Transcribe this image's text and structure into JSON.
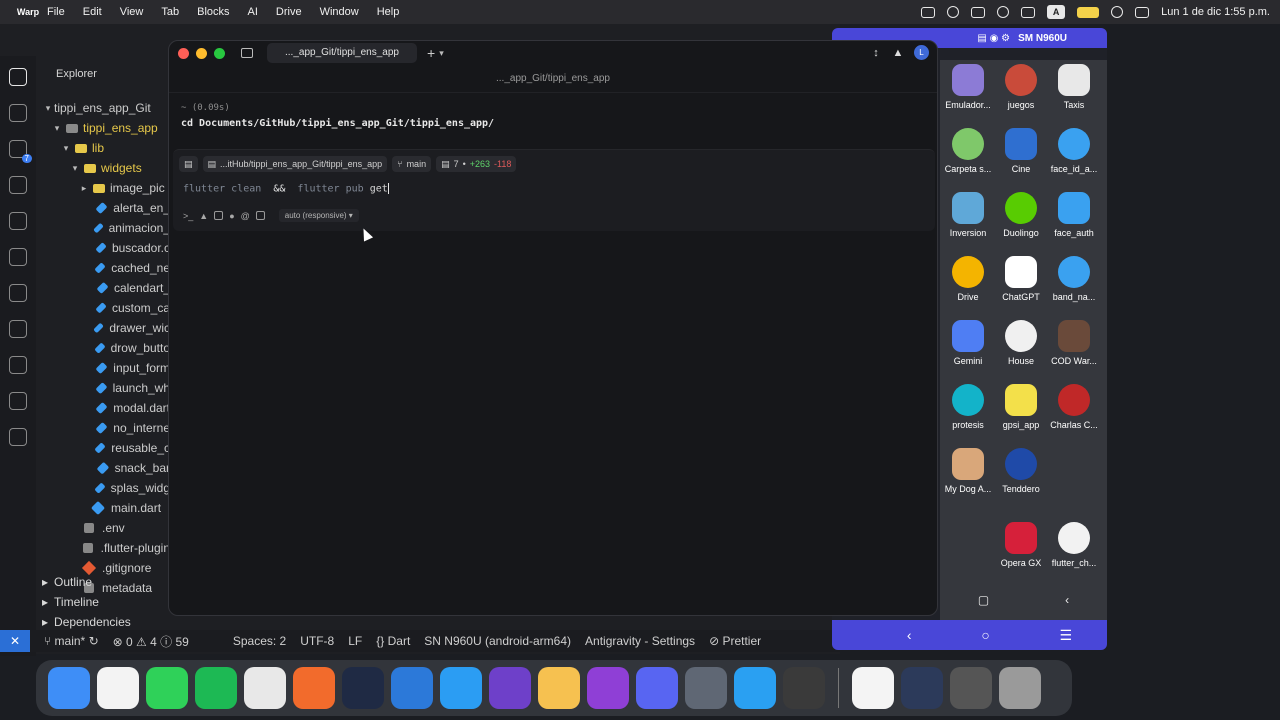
{
  "menubar": {
    "app_name": "Warp",
    "items": [
      "File",
      "Edit",
      "View",
      "Tab",
      "Blocks",
      "AI",
      "Drive",
      "Window",
      "Help"
    ],
    "input_badge": "A",
    "clock": "Lun 1 de dic  1:55 p.m."
  },
  "vscode": {
    "explorer_title": "Explorer",
    "tree": [
      {
        "label": "tippi_ens_app_Git",
        "kind": "root"
      },
      {
        "label": "tippi_ens_app",
        "kind": "folder-open"
      },
      {
        "label": "lib",
        "kind": "folder-open"
      },
      {
        "label": "widgets",
        "kind": "folder-open"
      },
      {
        "label": "image_pic",
        "kind": "folder"
      },
      {
        "label": "alerta_en_",
        "kind": "dart"
      },
      {
        "label": "animacion_",
        "kind": "dart"
      },
      {
        "label": "buscador.c",
        "kind": "dart"
      },
      {
        "label": "cached_ne",
        "kind": "dart"
      },
      {
        "label": "calendart_",
        "kind": "dart"
      },
      {
        "label": "custom_ca",
        "kind": "dart"
      },
      {
        "label": "drawer_wic",
        "kind": "dart"
      },
      {
        "label": "drow_butto",
        "kind": "dart"
      },
      {
        "label": "input_form",
        "kind": "dart"
      },
      {
        "label": "launch_wh",
        "kind": "dart"
      },
      {
        "label": "modal.dart",
        "kind": "dart"
      },
      {
        "label": "no_interne",
        "kind": "dart"
      },
      {
        "label": "reusable_c",
        "kind": "dart"
      },
      {
        "label": "snack_bar",
        "kind": "dart"
      },
      {
        "label": "splas_widg",
        "kind": "dart"
      },
      {
        "label": "main.dart",
        "kind": "dart"
      },
      {
        "label": ".env",
        "kind": "misc"
      },
      {
        "label": ".flutter-plugin",
        "kind": "misc"
      },
      {
        "label": ".gitignore",
        "kind": "git"
      },
      {
        "label": "metadata",
        "kind": "misc"
      }
    ],
    "sections": [
      "Outline",
      "Timeline",
      "Dependencies"
    ],
    "statusbar": {
      "branch": "main*",
      "problems": "0",
      "warnings": "4",
      "infos": "59",
      "spaces": "Spaces: 2",
      "encoding": "UTF-8",
      "eol": "LF",
      "language": "Dart",
      "device": "SN N960U (android-arm64)",
      "settings": "Antigravity - Settings",
      "formatter": "Prettier"
    }
  },
  "warp": {
    "tab_title": "..._app_Git/tippi_ens_app",
    "path_title": "..._app_Git/tippi_ens_app",
    "prev_block": {
      "duration": "~ (0.09s)",
      "command": "cd Documents/GitHub/tippi_ens_app_Git/tippi_ens_app/"
    },
    "input": {
      "cwd_chip": "...itHub/tippi_ens_app_Git/tippi_ens_app",
      "branch_chip": "main",
      "changes_files": "7",
      "changes_added": "+263",
      "changes_removed": "-118",
      "cmd_part1": "flutter clean",
      "cmd_op": "&&",
      "cmd_part2": "flutter pub",
      "cmd_typed": "get",
      "mode": "auto (responsive)",
      "avatar_letter": "L"
    }
  },
  "phone": {
    "device_name": "SM N960U",
    "apps": [
      {
        "label": "Emulador...",
        "color": "#8c7bd6"
      },
      {
        "label": "juegos",
        "color": "#c94b3a"
      },
      {
        "label": "Taxis",
        "color": "#e8e8e8"
      },
      {
        "label": "Carpeta s...",
        "color": "#7fc86a"
      },
      {
        "label": "Cine",
        "color": "#2f6fd0"
      },
      {
        "label": "face_id_a...",
        "color": "#3aa1f0"
      },
      {
        "label": "Inversion",
        "color": "#5fa8d8"
      },
      {
        "label": "Duolingo",
        "color": "#58cc02"
      },
      {
        "label": "face_auth",
        "color": "#3aa1f0"
      },
      {
        "label": "Drive",
        "color": "#f4b400"
      },
      {
        "label": "ChatGPT",
        "color": "#ffffff"
      },
      {
        "label": "band_na...",
        "color": "#3aa1f0"
      },
      {
        "label": "Gemini",
        "color": "#4f7ef3"
      },
      {
        "label": "House",
        "color": "#f0f0f0"
      },
      {
        "label": "COD War...",
        "color": "#6a4a3a"
      },
      {
        "label": "protesis",
        "color": "#13b3c9"
      },
      {
        "label": "gpsi_app",
        "color": "#f3e04a"
      },
      {
        "label": "Charlas C...",
        "color": "#c02828"
      },
      {
        "label": "My Dog A...",
        "color": "#d9a77a"
      },
      {
        "label": "Tenddero",
        "color": "#1f4aa8"
      },
      {
        "label": "Opera GX",
        "color": "#d6203a"
      },
      {
        "label": "flutter_ch...",
        "color": "#f2f2f2"
      }
    ]
  },
  "dock": {
    "colors": [
      "#3e8ef7",
      "#f3f3f3",
      "#2fd159",
      "#1db954",
      "#e8e8e8",
      "#f26b2c",
      "#1f2a44",
      "#2c79d9",
      "#2b9df3",
      "#6e40c9",
      "#f6c150",
      "#8f3fd6",
      "#5865f2",
      "#5f6774",
      "#2aa0f2",
      "#3a3a3a",
      "#f4f4f4",
      "#2c3a5a",
      "#555",
      "#9a9a9a"
    ]
  }
}
